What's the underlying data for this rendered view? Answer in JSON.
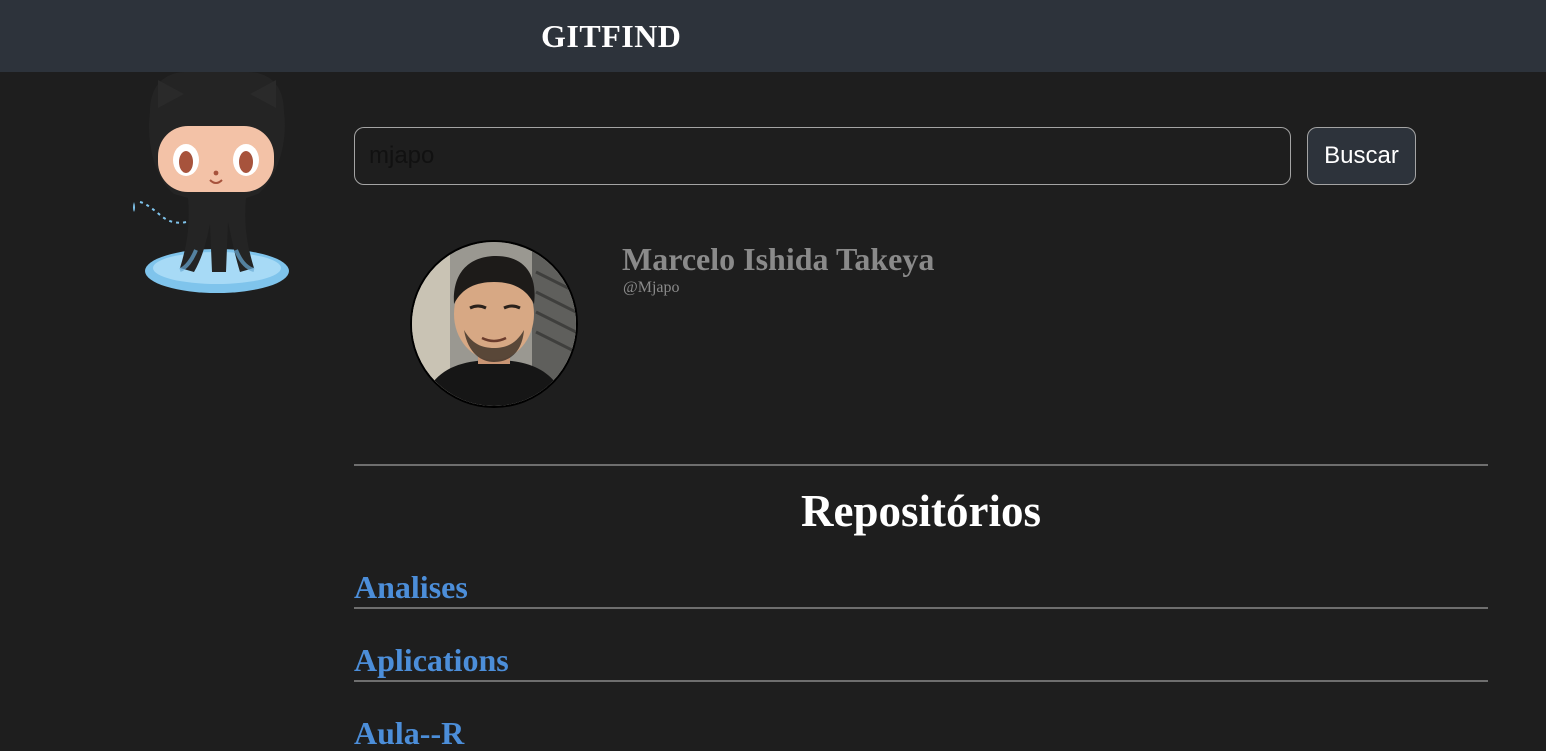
{
  "header": {
    "title": "GITFIND"
  },
  "search": {
    "value": "mjapo",
    "button_label": "Buscar"
  },
  "profile": {
    "name": "Marcelo Ishida Takeya",
    "login": "@Mjapo"
  },
  "repositories": {
    "title": "Repositórios",
    "items": [
      {
        "name": "Analises"
      },
      {
        "name": "Aplications"
      },
      {
        "name": "Aula--R"
      }
    ]
  },
  "colors": {
    "header_bg": "#2d333b",
    "page_bg": "#1e1e1e",
    "link": "#4c8ed9",
    "muted_text": "#8a8a8a"
  },
  "icons": {
    "mascot": "octocat-mascot-icon"
  }
}
